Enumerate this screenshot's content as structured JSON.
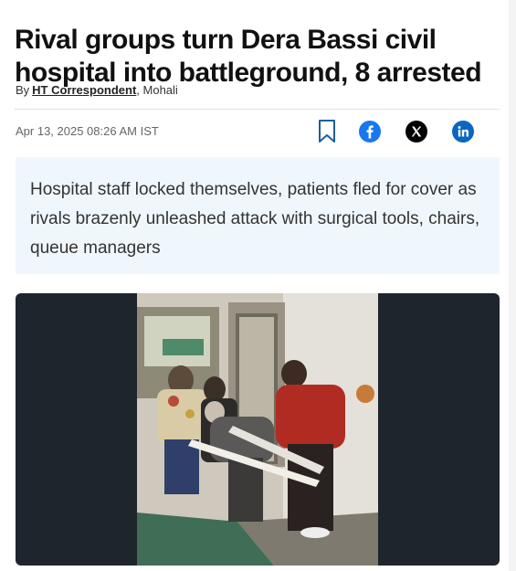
{
  "article": {
    "headline": "Rival groups turn Dera Bassi civil hospital into battleground, 8 arrested",
    "byline": {
      "prefix": "By",
      "author": "HT Correspondent",
      "location": ", Mohali"
    },
    "date": "Apr 13, 2025 08:26 AM IST",
    "summary": "Hospital staff locked themselves, patients fled for cover as rivals brazenly unleashed attack with surgical tools, chairs, queue managers"
  },
  "share": {
    "icons": [
      "bookmark-icon",
      "facebook-icon",
      "x-icon",
      "linkedin-icon"
    ],
    "colors": {
      "facebook": "#1877f2",
      "x": "#000000",
      "linkedin": "#0a66c2",
      "bookmark": "#1c5f9e"
    }
  },
  "colors": {
    "summary_bg": "#f0f7fc",
    "media_bg": "#1f252d"
  }
}
